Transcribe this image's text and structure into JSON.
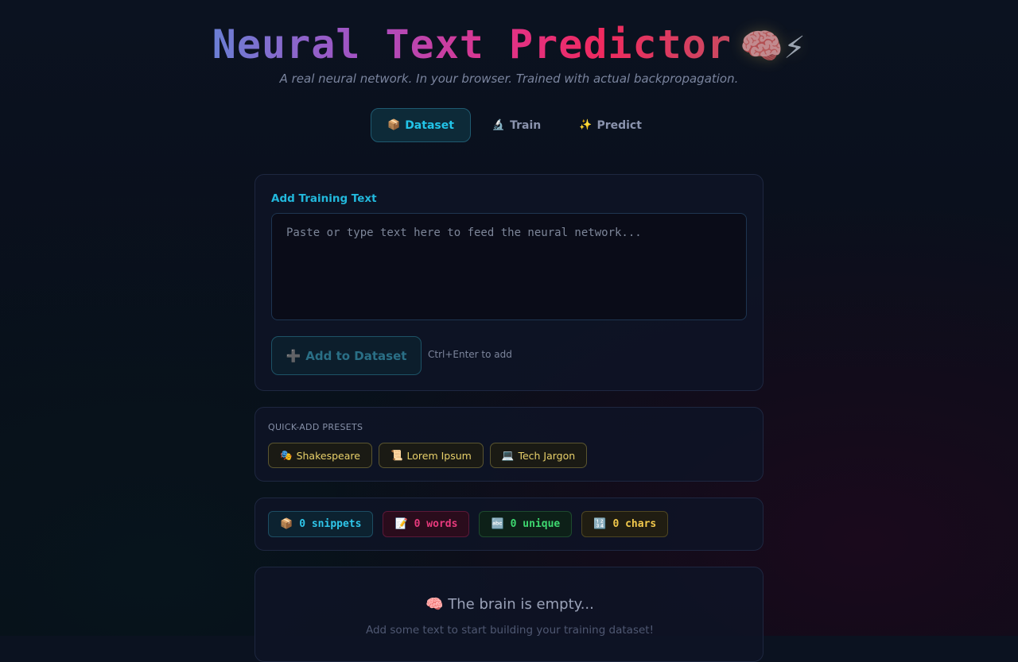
{
  "header": {
    "title": "Neural Text Predictor",
    "title_emoji": "🧠⚡",
    "subtitle": "A real neural network. In your browser. Trained with actual backpropagation."
  },
  "tabs": [
    {
      "icon": "📦",
      "label": "Dataset",
      "active": true
    },
    {
      "icon": "🔬",
      "label": "Train",
      "active": false
    },
    {
      "icon": "✨",
      "label": "Predict",
      "active": false
    }
  ],
  "input_card": {
    "label": "Add Training Text",
    "placeholder": "Paste or type text here to feed the neural network...",
    "value": "",
    "add_button_icon": "➕",
    "add_button_label": "Add to Dataset",
    "hint": "Ctrl+Enter to add"
  },
  "presets": {
    "label": "QUICK-ADD PRESETS",
    "items": [
      {
        "icon": "🎭",
        "label": "Shakespeare"
      },
      {
        "icon": "📜",
        "label": "Lorem Ipsum"
      },
      {
        "icon": "💻",
        "label": "Tech Jargon"
      }
    ]
  },
  "stats": [
    {
      "icon": "📦",
      "text": "0 snippets"
    },
    {
      "icon": "📝",
      "text": "0 words"
    },
    {
      "icon": "🔤",
      "text": "0 unique"
    },
    {
      "icon": "🔢",
      "text": "0 chars"
    }
  ],
  "empty_state": {
    "icon": "🧠",
    "title": "The brain is empty...",
    "subtitle": "Add some text to start building your training dataset!"
  },
  "colors": {
    "accent": "#22c4e8",
    "pink": "#e83a7d",
    "green": "#3ed870",
    "yellow": "#f2c94c"
  }
}
